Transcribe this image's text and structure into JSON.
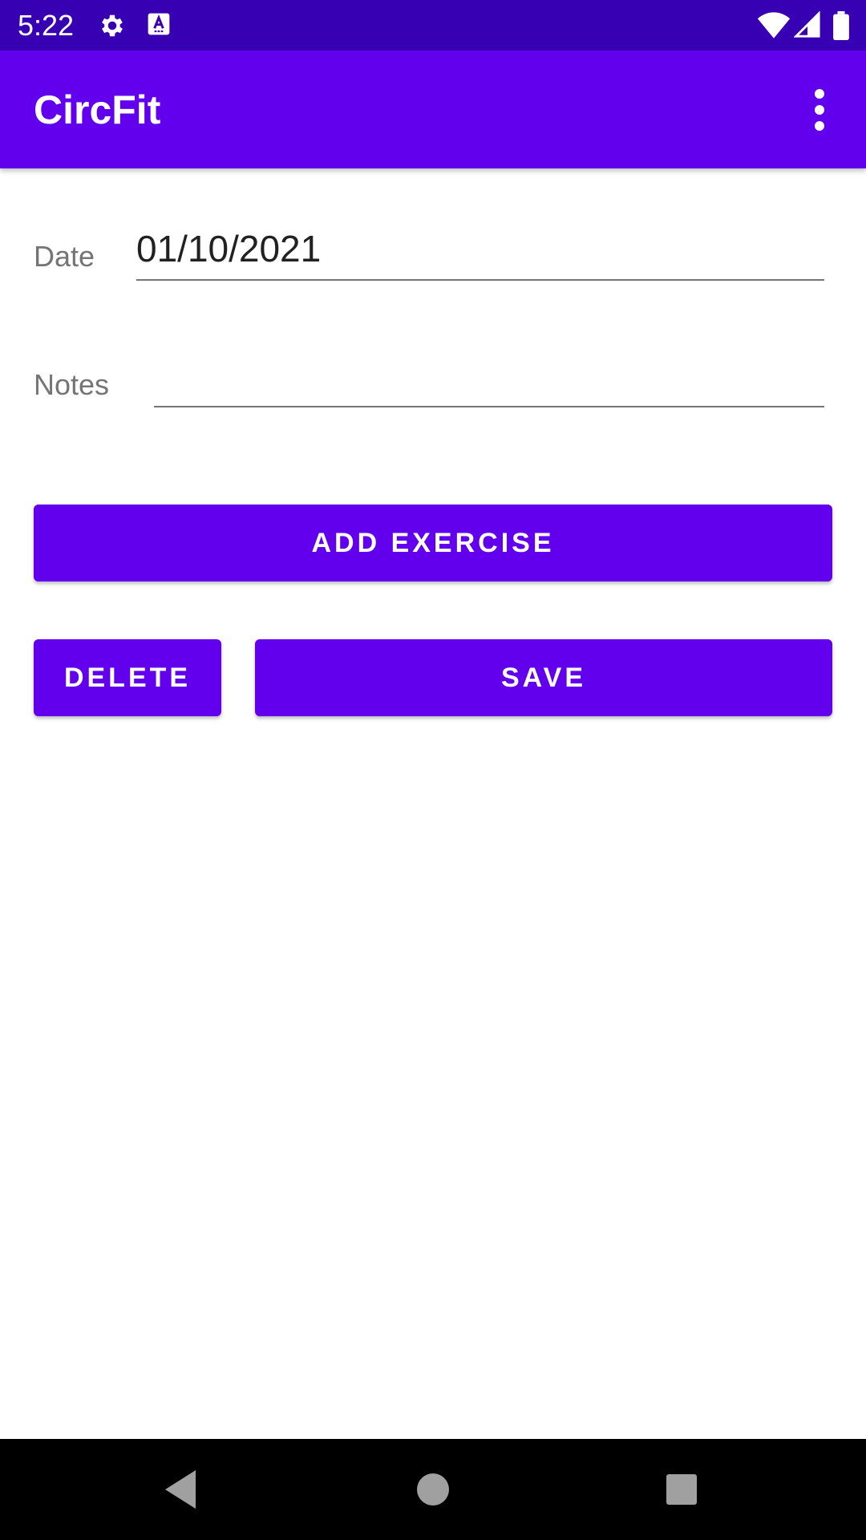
{
  "status_bar": {
    "time": "5:22",
    "icons": [
      "gear-icon",
      "font-a-icon",
      "wifi-icon",
      "cell-signal-icon",
      "battery-icon"
    ],
    "background": "#3700b3"
  },
  "app_bar": {
    "title": "CircFit",
    "menu_icon": "more-vert-icon",
    "background": "#6200ee"
  },
  "form": {
    "date_label": "Date",
    "date_value": "01/10/2021",
    "notes_label": "Notes",
    "notes_value": ""
  },
  "buttons": {
    "add_exercise": "ADD EXERCISE",
    "delete": "DELETE",
    "save": "SAVE",
    "color": "#6200ee"
  },
  "nav_bar": {
    "icons": [
      "back-triangle-icon",
      "home-circle-icon",
      "recents-square-icon"
    ]
  }
}
